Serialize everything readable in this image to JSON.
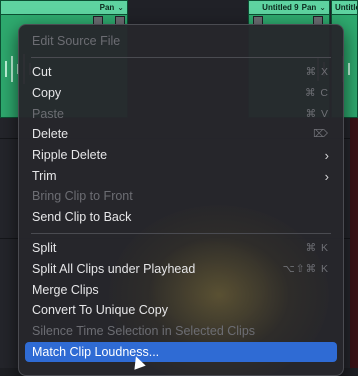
{
  "clips": [
    {
      "label": "Pan"
    },
    {
      "label": "Untitled 9",
      "pan": "Pan"
    },
    {
      "label": "Untitle"
    }
  ],
  "menu": {
    "items": [
      {
        "label": "Edit Source File",
        "shortcut": "",
        "disabled": true
      },
      {
        "label": "Cut",
        "shortcut": "⌘ X"
      },
      {
        "label": "Copy",
        "shortcut": "⌘ C"
      },
      {
        "label": "Paste",
        "shortcut": "⌘ V",
        "disabled": true
      },
      {
        "label": "Delete",
        "shortcut": "⌦"
      },
      {
        "label": "Ripple Delete",
        "submenu": true
      },
      {
        "label": "Trim",
        "submenu": true
      },
      {
        "label": "Bring Clip to Front",
        "disabled": true
      },
      {
        "label": "Send Clip to Back"
      },
      {
        "label": "Split",
        "shortcut": "⌘ K"
      },
      {
        "label": "Split All Clips under Playhead",
        "shortcut": "⌥⇧⌘ K"
      },
      {
        "label": "Merge Clips"
      },
      {
        "label": "Convert To Unique Copy"
      },
      {
        "label": "Silence Time Selection in Selected Clips",
        "disabled": true
      },
      {
        "label": "Match Clip Loudness...",
        "highlighted": true
      }
    ]
  },
  "colors": {
    "clip": "#2ea96e",
    "highlight": "#2f6bd4"
  }
}
